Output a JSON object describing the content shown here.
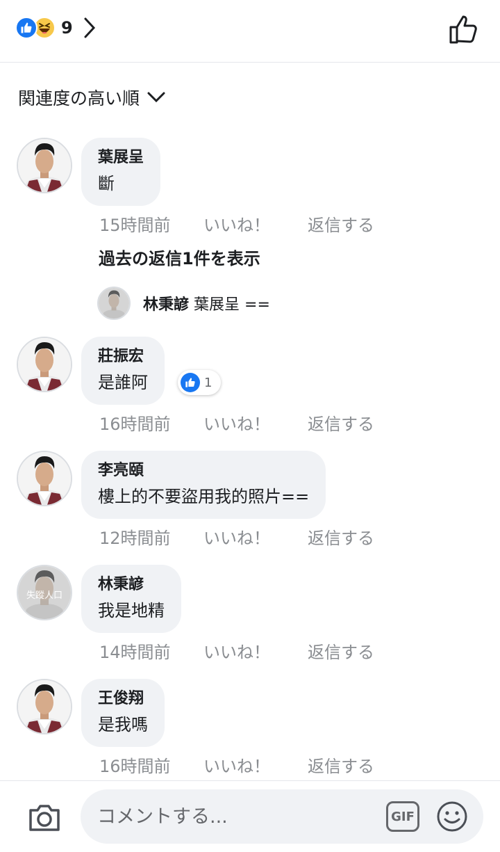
{
  "header": {
    "reaction_count": "9"
  },
  "sort": {
    "label": "関連度の高い順"
  },
  "comments": [
    {
      "name": "葉展呈",
      "text": "斷",
      "time": "15時間前",
      "like_label": "いいね！",
      "reply_label": "返信する",
      "view_previous": "過去の返信1件を表示",
      "nested_reply": {
        "name": "林秉諺",
        "text": "葉展呈 =="
      }
    },
    {
      "name": "莊振宏",
      "text": "是誰阿",
      "time": "16時間前",
      "like_label": "いいね！",
      "reply_label": "返信する",
      "reaction_count": "1"
    },
    {
      "name": "李亮頤",
      "text": "樓上的不要盜用我的照片==",
      "time": "12時間前",
      "like_label": "いいね！",
      "reply_label": "返信する"
    },
    {
      "name": "林秉諺",
      "text": "我是地精",
      "time": "14時間前",
      "like_label": "いいね！",
      "reply_label": "返信する",
      "avatar_overlay": "失蹤人口"
    },
    {
      "name": "王俊翔",
      "text": "是我嗎",
      "time": "16時間前",
      "like_label": "いいね！",
      "reply_label": "返信する"
    }
  ],
  "composer": {
    "placeholder": "コメントする...",
    "gif_label": "GIF"
  },
  "colors": {
    "accent": "#1877f2",
    "bubble": "#f0f2f5",
    "meta": "#8a8d91"
  }
}
